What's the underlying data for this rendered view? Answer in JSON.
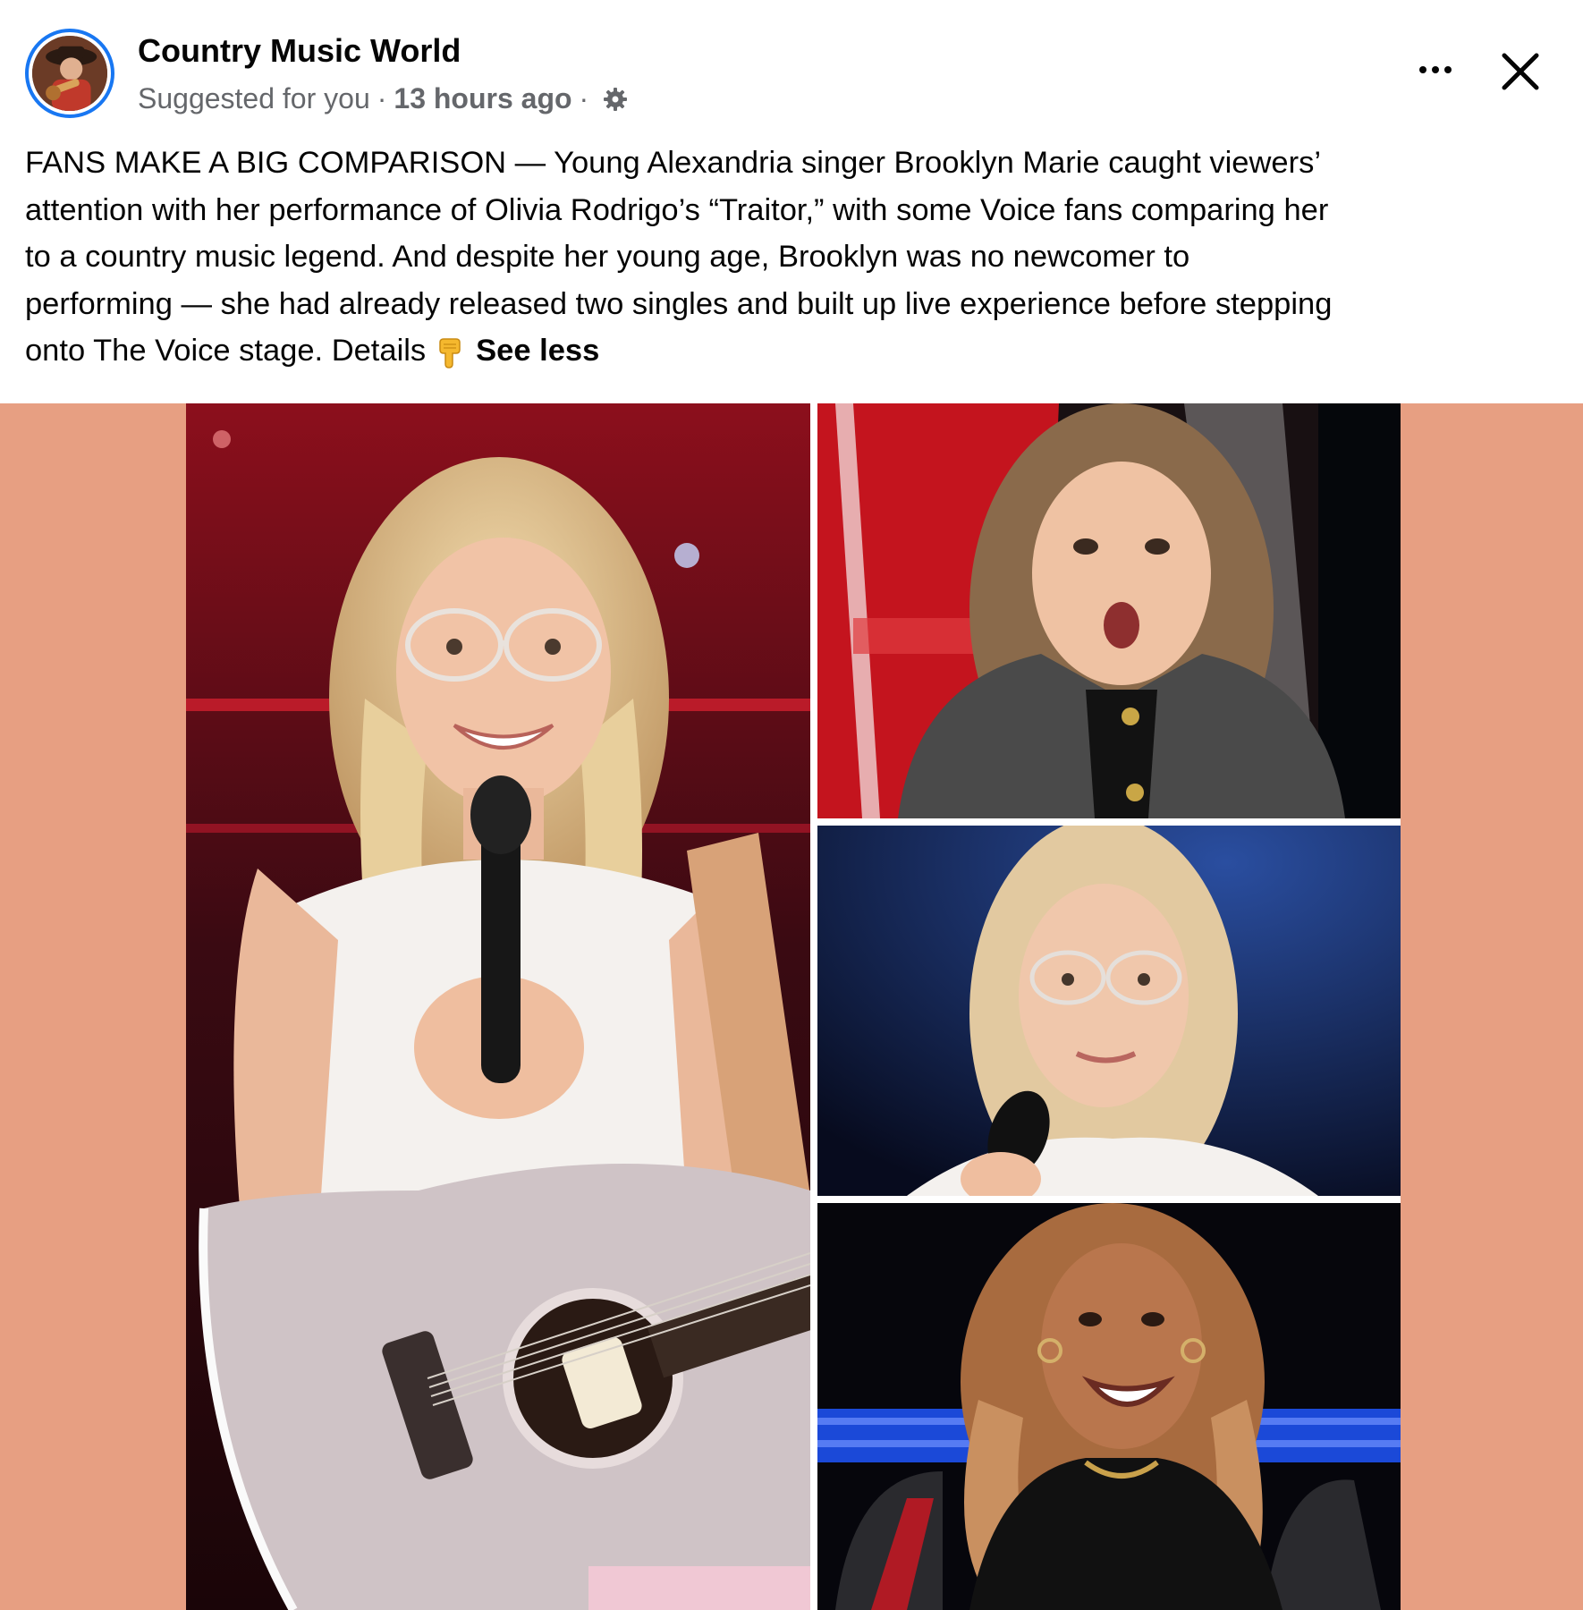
{
  "post": {
    "page_name": "Country Music World",
    "suggested": "Suggested for you",
    "separator": "·",
    "time": "13 hours ago",
    "text_lines": [
      "FANS MAKE A BIG COMPARISON — Young Alexandria singer Brooklyn Marie caught viewers’",
      "attention with her performance of Olivia Rodrigo’s “Traitor,” with some Voice fans comparing her",
      "to a country music legend.  And despite her young age, Brooklyn was no newcomer to",
      "performing — she had already released two singles and built up live experience before stepping",
      "onto The Voice stage. Details"
    ],
    "see_less": "See less"
  },
  "icons": {
    "gear": "gear-icon",
    "more": "more-options-icon",
    "close": "close-icon",
    "finger": "pointing-down-emoji"
  },
  "colors": {
    "brand_blue": "#1877f2",
    "media_background": "#e79f82",
    "secondary_text": "#65676b"
  }
}
